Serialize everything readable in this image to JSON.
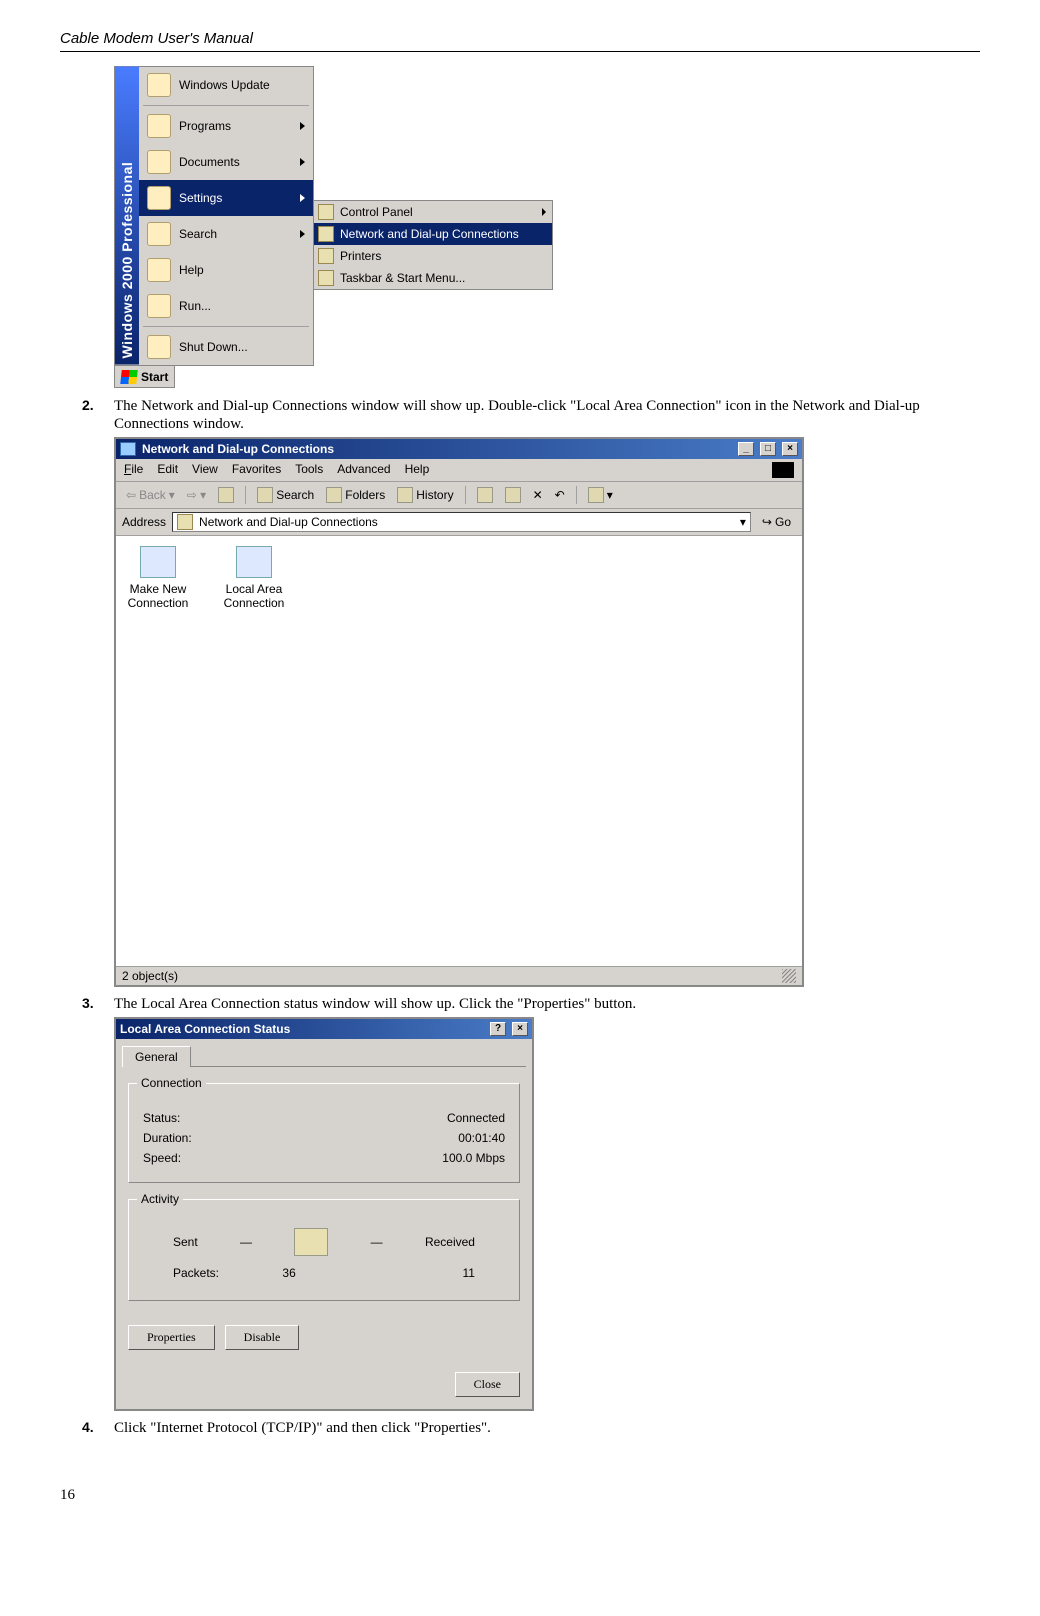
{
  "header": {
    "title": "Cable Modem User's Manual"
  },
  "page_number": "16",
  "steps": {
    "s2": {
      "num": "2.",
      "text": "The Network and Dial-up Connections window will show up. Double-click \"Local Area Connection\" icon in the Network and Dial-up Connections window."
    },
    "s3": {
      "num": "3.",
      "text": "The Local Area Connection status window will show up. Click the \"Properties\" button."
    },
    "s4": {
      "num": "4.",
      "text": "Click \"Internet Protocol (TCP/IP)\" and then click \"Properties\"."
    }
  },
  "start_menu": {
    "banner": "Windows 2000 Professional",
    "items": {
      "windows_update": "Windows Update",
      "programs": "Programs",
      "documents": "Documents",
      "settings": "Settings",
      "search": "Search",
      "help": "Help",
      "run": "Run...",
      "shutdown": "Shut Down..."
    },
    "submenu": {
      "control_panel": "Control Panel",
      "network": "Network and Dial-up Connections",
      "printers": "Printers",
      "taskbar": "Taskbar & Start Menu..."
    },
    "start_button": "Start"
  },
  "explorer": {
    "title": "Network and Dial-up Connections",
    "menu": {
      "file": "File",
      "edit": "Edit",
      "view": "View",
      "favorites": "Favorites",
      "tools": "Tools",
      "advanced": "Advanced",
      "help": "Help"
    },
    "toolbar": {
      "back": "Back",
      "search": "Search",
      "folders": "Folders",
      "history": "History"
    },
    "address_label": "Address",
    "address_value": "Network and Dial-up Connections",
    "go": "Go",
    "icons": {
      "make_new": "Make New Connection",
      "local_area": "Local Area Connection"
    },
    "status": "2 object(s)"
  },
  "status_dialog": {
    "title": "Local Area Connection Status",
    "tab_general": "General",
    "group_connection": "Connection",
    "status_label": "Status:",
    "status_value": "Connected",
    "duration_label": "Duration:",
    "duration_value": "00:01:40",
    "speed_label": "Speed:",
    "speed_value": "100.0 Mbps",
    "group_activity": "Activity",
    "sent": "Sent",
    "received": "Received",
    "packets_label": "Packets:",
    "packets_sent": "36",
    "packets_received": "11",
    "btn_properties": "Properties",
    "btn_disable": "Disable",
    "btn_close": "Close"
  }
}
